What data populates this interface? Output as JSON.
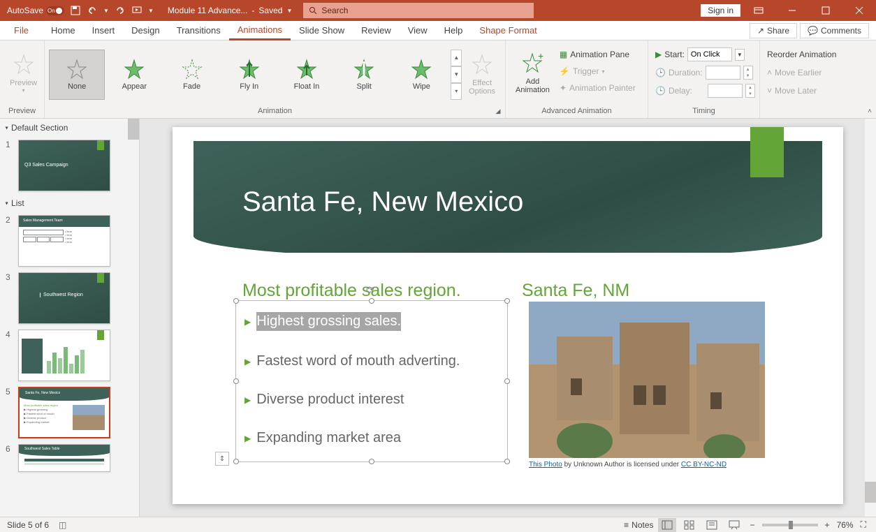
{
  "title_bar": {
    "autosave_label": "AutoSave",
    "autosave_state": "On",
    "doc_name": "Module 11 Advance...",
    "save_state": "Saved",
    "search_placeholder": "Search",
    "signin": "Sign in"
  },
  "tabs": {
    "file": "File",
    "home": "Home",
    "insert": "Insert",
    "design": "Design",
    "transitions": "Transitions",
    "animations": "Animations",
    "slideshow": "Slide Show",
    "review": "Review",
    "view": "View",
    "help": "Help",
    "shape_format": "Shape Format",
    "share": "Share",
    "comments": "Comments"
  },
  "ribbon": {
    "preview_group": "Preview",
    "preview_btn": "Preview",
    "animation_group": "Animation",
    "anim_none": "None",
    "anim_appear": "Appear",
    "anim_fade": "Fade",
    "anim_flyin": "Fly In",
    "anim_floatin": "Float In",
    "anim_split": "Split",
    "anim_wipe": "Wipe",
    "effect_options": "Effect\nOptions",
    "advanced_group": "Advanced Animation",
    "add_animation": "Add\nAnimation",
    "animation_pane": "Animation Pane",
    "trigger": "Trigger",
    "animation_painter": "Animation Painter",
    "timing_group": "Timing",
    "start_label": "Start:",
    "start_value": "On Click",
    "duration_label": "Duration:",
    "delay_label": "Delay:",
    "reorder_label": "Reorder Animation",
    "move_earlier": "Move Earlier",
    "move_later": "Move Later"
  },
  "thumbnails": {
    "section_default": "Default Section",
    "section_list": "List",
    "slide1_title": "Q3 Sales Campaign",
    "slide2_title": "Sales Management Team",
    "slide3_title": "Southwest Region",
    "slide5_title": "Santa Fe, New Mexico",
    "slide6_title": "Southwest Sales Table"
  },
  "slide": {
    "title": "Santa Fe, New Mexico",
    "left_heading": "Most profitable sales region.",
    "right_heading": "Santa Fe, NM",
    "bullets": [
      "Highest grossing sales.",
      "Fastest word of mouth adverting.",
      "Diverse product interest",
      "Expanding market area"
    ],
    "caption_link1": "This Photo",
    "caption_text": " by Unknown Author is licensed under ",
    "caption_link2": "CC BY-NC-ND"
  },
  "status": {
    "slide_info": "Slide 5 of 6",
    "notes": "Notes",
    "zoom": "76%"
  }
}
